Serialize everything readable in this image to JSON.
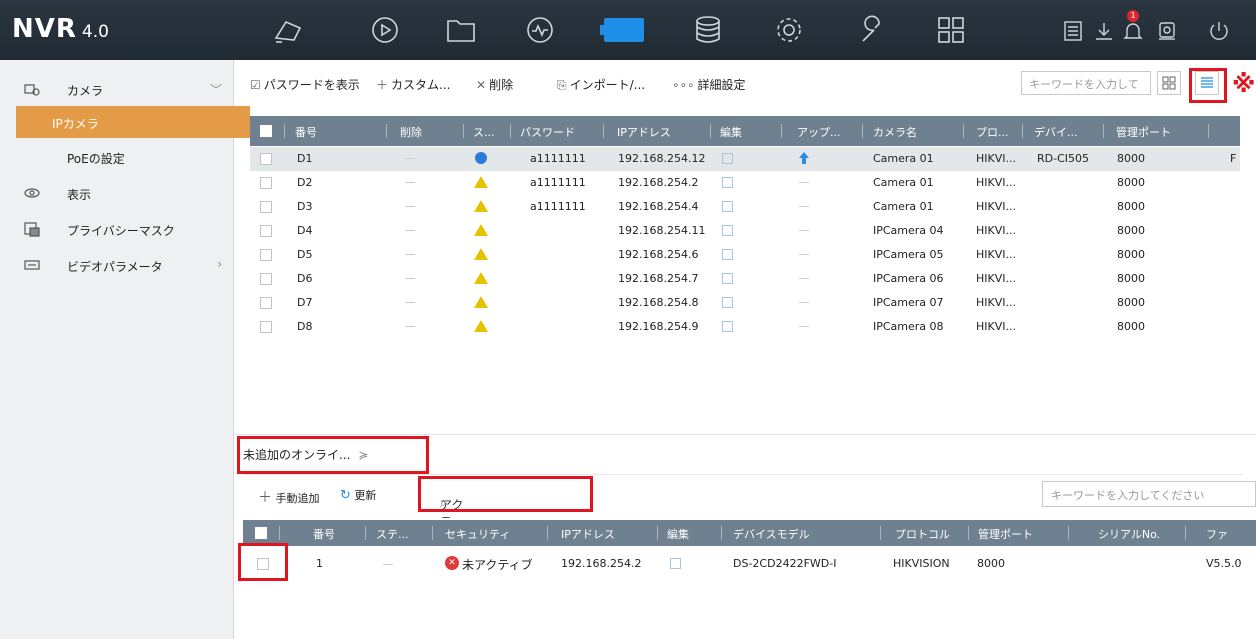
{
  "brand": {
    "name": "NVR",
    "version": "4.0"
  },
  "top_nav": [
    "camera-mode-icon",
    "playback-icon",
    "file-icon",
    "smart-analysis-icon",
    "camera-config-icon",
    "storage-icon",
    "system-settings-icon",
    "maintenance-icon",
    "grid-icon"
  ],
  "top_right": [
    "log-icon",
    "download-icon",
    "alarm-icon",
    "lock-icon",
    "power-icon"
  ],
  "alarm_count": "1",
  "sidebar": {
    "camera": "カメラ",
    "ip_camera": "IPカメラ",
    "poe": "PoEの設定",
    "display": "表示",
    "privacy_mask": "プライバシーマスク",
    "video_params": "ビデオパラメータ"
  },
  "toolbar": {
    "show_password": "パスワードを表示",
    "custom": "カスタム...",
    "delete": "削除",
    "import": "インポート/...",
    "details": "詳細設定",
    "keyword_placeholder": "キーワードを入力して",
    "note_mark": "※"
  },
  "table": {
    "headers": [
      "番号",
      "削除",
      "ス...",
      "パスワード",
      "IPアドレス",
      "編集",
      "アップ...",
      "カメラ名",
      "プロ...",
      "デバイ...",
      "管理ポート"
    ],
    "rows": [
      {
        "no": "D1",
        "password": "a1111111",
        "ip": "192.168.254.12",
        "name": "Camera 01",
        "proto": "HIKVI...",
        "model": "RD-CI505",
        "port": "8000",
        "extra": "F"
      },
      {
        "no": "D2",
        "password": "a1111111",
        "ip": "192.168.254.2",
        "name": "Camera 01",
        "proto": "HIKVI...",
        "model": "",
        "port": "8000",
        "extra": ""
      },
      {
        "no": "D3",
        "password": "a1111111",
        "ip": "192.168.254.4",
        "name": "Camera 01",
        "proto": "HIKVI...",
        "model": "",
        "port": "8000",
        "extra": ""
      },
      {
        "no": "D4",
        "password": "",
        "ip": "192.168.254.11",
        "name": "IPCamera 04",
        "proto": "HIKVI...",
        "model": "",
        "port": "8000",
        "extra": ""
      },
      {
        "no": "D5",
        "password": "",
        "ip": "192.168.254.6",
        "name": "IPCamera 05",
        "proto": "HIKVI...",
        "model": "",
        "port": "8000",
        "extra": ""
      },
      {
        "no": "D6",
        "password": "",
        "ip": "192.168.254.7",
        "name": "IPCamera 06",
        "proto": "HIKVI...",
        "model": "",
        "port": "8000",
        "extra": ""
      },
      {
        "no": "D7",
        "password": "",
        "ip": "192.168.254.8",
        "name": "IPCamera 07",
        "proto": "HIKVI...",
        "model": "",
        "port": "8000",
        "extra": ""
      },
      {
        "no": "D8",
        "password": "",
        "ip": "192.168.254.9",
        "name": "IPCamera 08",
        "proto": "HIKVI...",
        "model": "",
        "port": "8000",
        "extra": ""
      }
    ]
  },
  "lower": {
    "title": "未追加のオンライ...",
    "manual_add": "手動追加",
    "refresh": "更新",
    "activate": "アクテ...",
    "keyword_placeholder": "キーワードを入力してください",
    "headers": [
      "番号",
      "ステ...",
      "セキュリティ",
      "IPアドレス",
      "編集",
      "デバイスモデル",
      "プロトコル",
      "管理ポート",
      "シリアルNo.",
      "ファ"
    ],
    "row": {
      "no": "1",
      "security": "未アクティブ",
      "ip": "192.168.254.2",
      "model": "DS-2CD2422FWD-I",
      "proto": "HIKVISION",
      "port": "8000",
      "fw": "V5.5.0"
    }
  }
}
